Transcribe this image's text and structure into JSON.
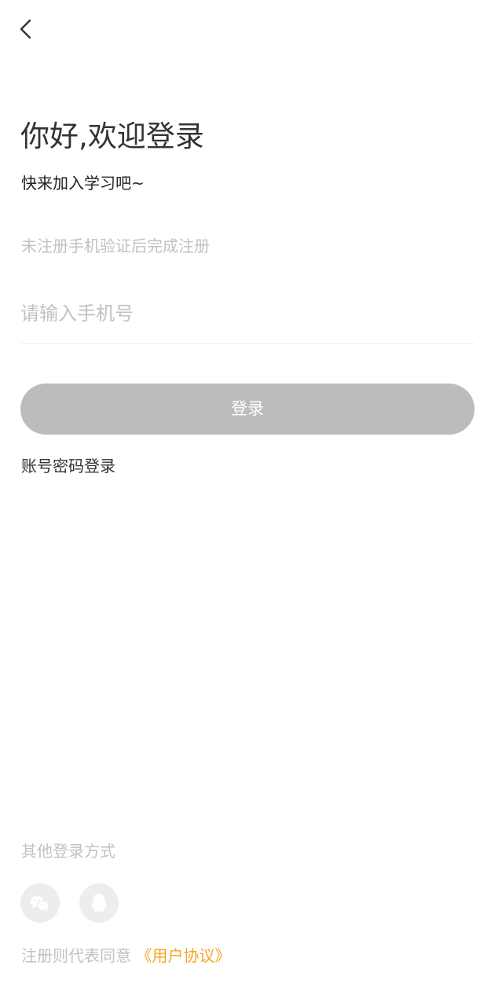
{
  "header": {
    "back_icon": "chevron-left-icon"
  },
  "welcome": {
    "title": "你好,欢迎登录",
    "subtitle": "快来加入学习吧~"
  },
  "form": {
    "hint": "未注册手机验证后完成注册",
    "phone_placeholder": "请输入手机号",
    "phone_value": "",
    "login_label": "登录",
    "password_login_label": "账号密码登录"
  },
  "other_login": {
    "title": "其他登录方式",
    "methods": [
      {
        "icon": "wechat-icon"
      },
      {
        "icon": "qq-icon"
      }
    ]
  },
  "agreement": {
    "prefix": "注册则代表同意",
    "link": "《用户协议》"
  },
  "colors": {
    "accent": "#f5a623",
    "button_disabled": "#bcbcbc",
    "placeholder": "#c2c2c2",
    "text": "#333333",
    "icon_bg": "#ededed"
  }
}
